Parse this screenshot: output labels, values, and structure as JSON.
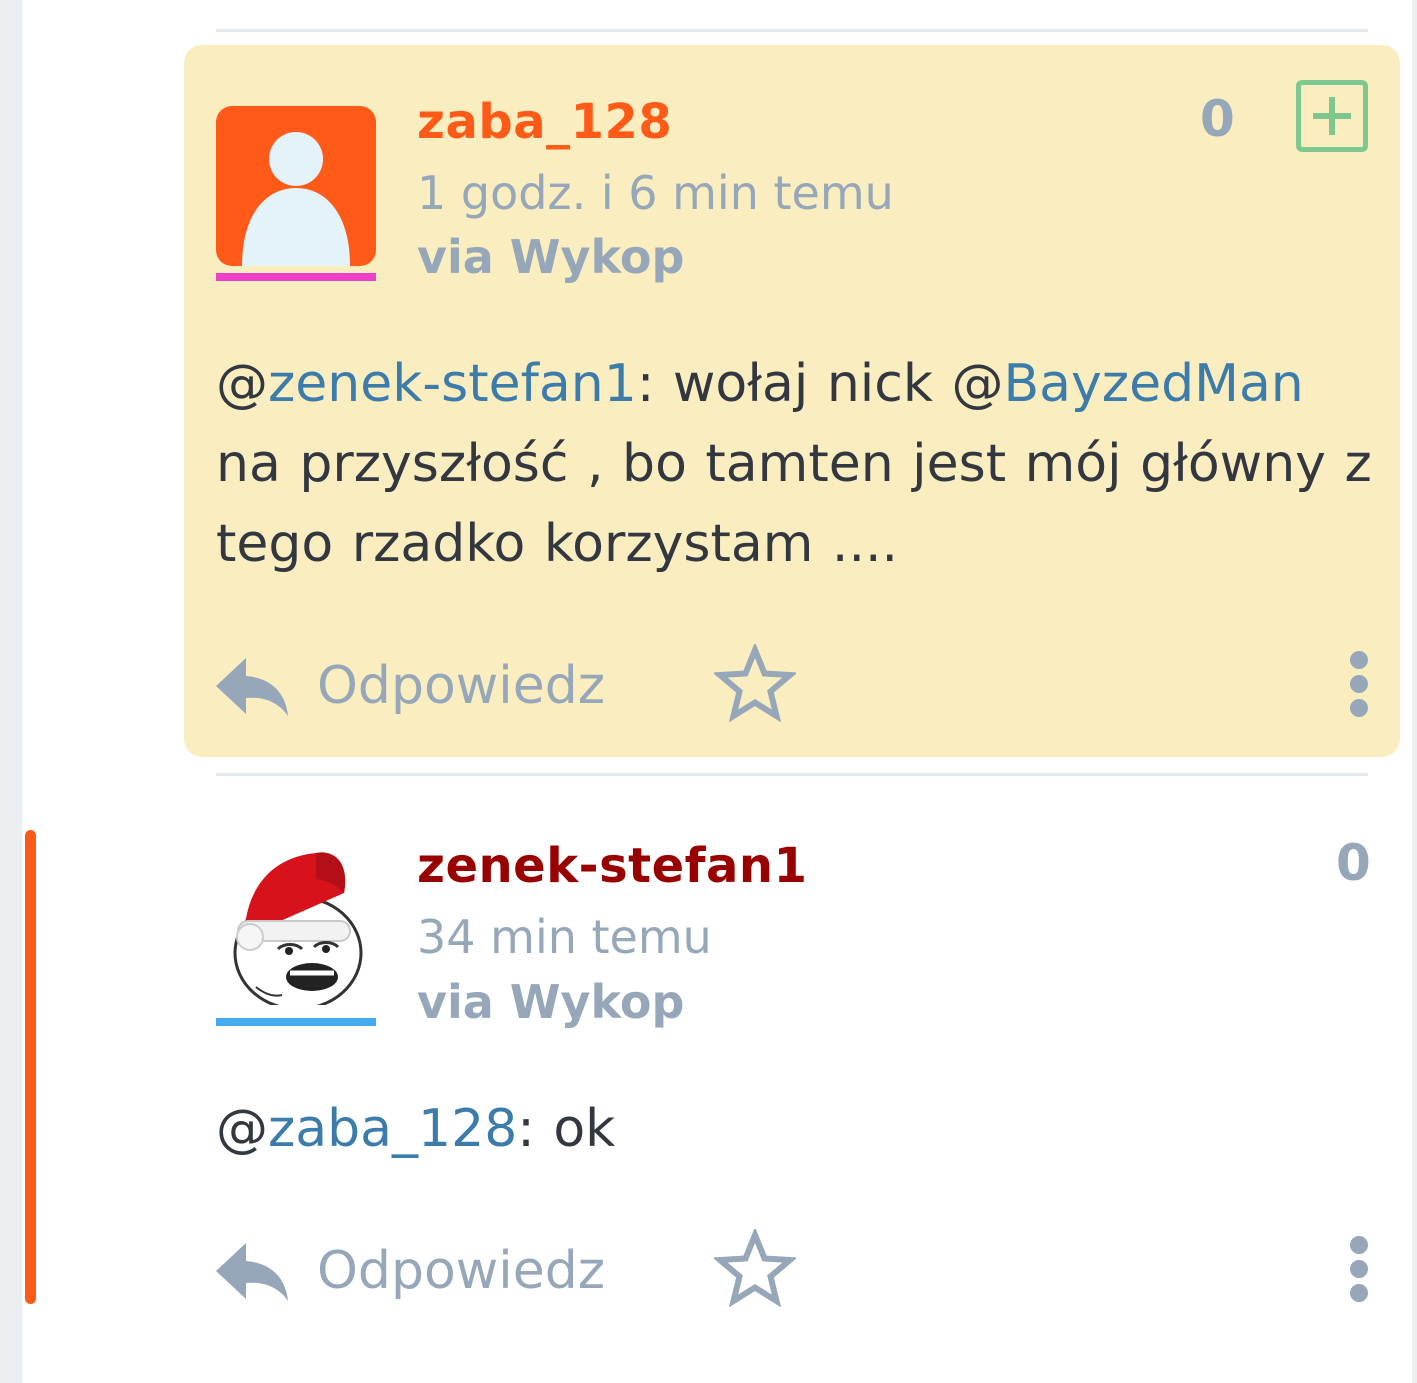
{
  "comments": [
    {
      "username": "zaba_128",
      "username_color": "#ff5a18",
      "time": "1 godz. i 6 min temu",
      "via": "via Wykop",
      "score": "0",
      "avatar": "default-user-avatar",
      "gender_color": "#ef3fc8",
      "body": {
        "at1": "@",
        "mention1": "zenek-stefan1",
        "text1": ": wołaj nick @",
        "mention2": "BayzedMan",
        "text2": " na przyszłość , bo tamten jest mój główny z tego rzadko korzystam ...."
      },
      "reply_label": "Odpowiedz",
      "highlighted": true
    },
    {
      "username": "zenek-stefan1",
      "username_color": "#990000",
      "time": "34 min temu",
      "via": "via Wykop",
      "score": "0",
      "avatar": "santa-hat-meme-face",
      "gender_color": "#46abf1",
      "body": {
        "at1": "@",
        "mention1": "zaba_128",
        "text1": ": ok"
      },
      "reply_label": "Odpowiedz",
      "highlighted": false
    }
  ],
  "icons": {
    "plus": "plus-icon",
    "reply": "reply-icon",
    "favorite": "star-icon",
    "more": "more-vertical-icon"
  },
  "colors": {
    "highlight_bg": "#faedc0",
    "mention": "#3c7cab",
    "muted": "#95a7b8",
    "thread_line": "#ff5917",
    "plus_green": "#7ec890"
  }
}
